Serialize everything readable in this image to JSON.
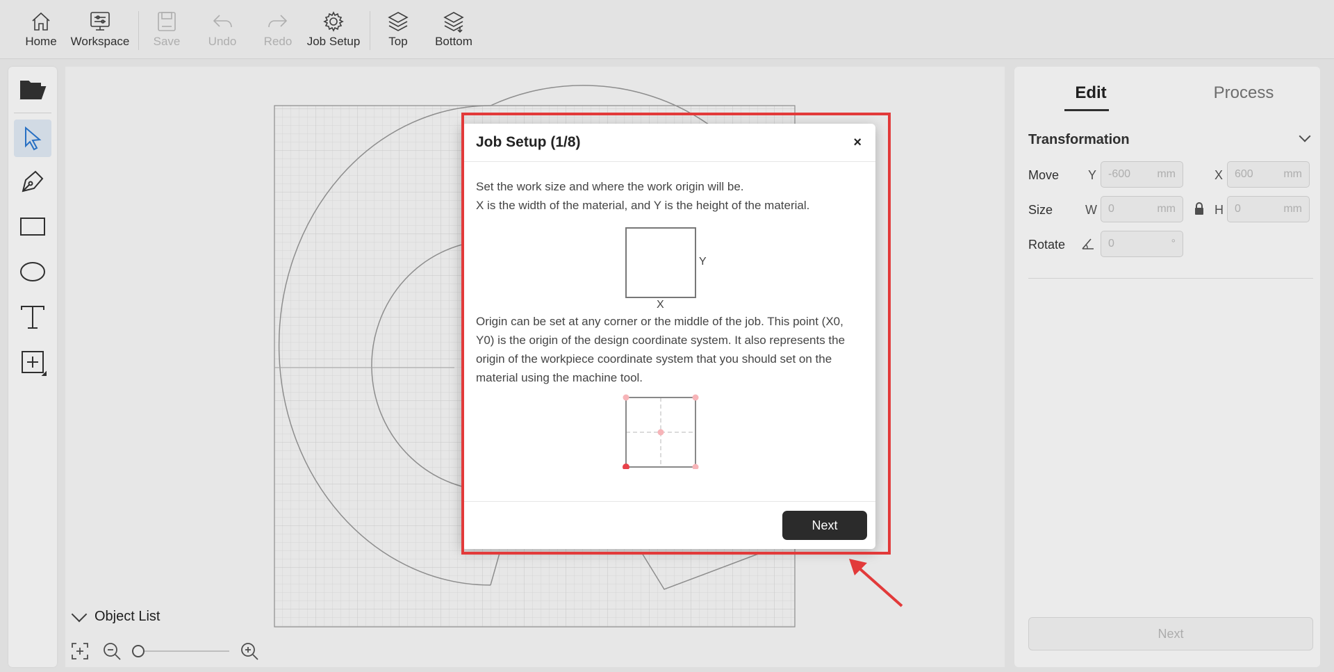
{
  "toolbar": {
    "home": "Home",
    "workspace": "Workspace",
    "save": "Save",
    "undo": "Undo",
    "redo": "Redo",
    "job_setup": "Job Setup",
    "top": "Top",
    "bottom": "Bottom"
  },
  "left_tools": [
    "folder-open-icon",
    "select-icon",
    "pen-icon",
    "rectangle-icon",
    "ellipse-icon",
    "text-icon",
    "image-frame-icon"
  ],
  "canvas": {
    "object_list_label": "Object List"
  },
  "right_panel": {
    "tabs": [
      "Edit",
      "Process"
    ],
    "section_title": "Transformation",
    "move_label": "Move",
    "size_label": "Size",
    "rotate_label": "Rotate",
    "move_y_axis": "Y",
    "move_y_placeholder": "-600",
    "move_x_axis": "X",
    "move_x_placeholder": "600",
    "size_w_axis": "W",
    "size_w_placeholder": "0",
    "size_h_axis": "H",
    "size_h_placeholder": "0",
    "rotate_placeholder": "0",
    "unit_mm": "mm",
    "unit_deg": "°",
    "next_button": "Next"
  },
  "dialog": {
    "title": "Job Setup (1/8)",
    "close": "×",
    "para1_line1": "Set the work size and where the work origin will be.",
    "para1_line2": "X is the width of the material, and Y is the height of the material.",
    "fig_x": "X",
    "fig_y": "Y",
    "para2": "Origin can be set at any corner or the middle of the job. This point (X0, Y0) is the origin of the design coordinate system. It also represents the origin of the workpiece coordinate system that you should set on the material using the machine tool.",
    "next_button": "Next"
  },
  "colors": {
    "highlight": "#e23a3a",
    "accent_blue": "#2c7ad4",
    "origin_dot": "#e8414a",
    "origin_dot_light": "#f7b4b8",
    "dark_button": "#2b2b2b"
  }
}
